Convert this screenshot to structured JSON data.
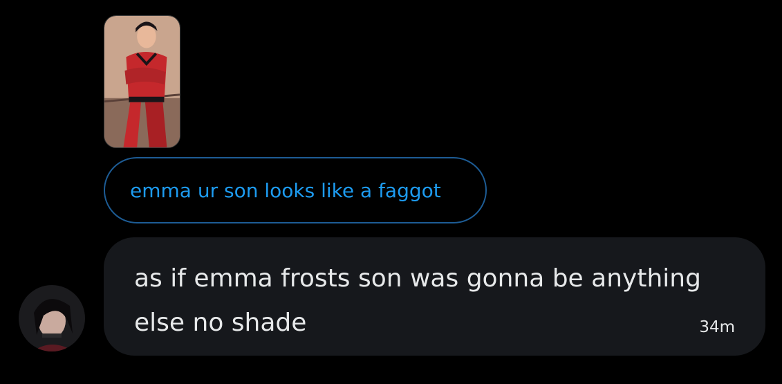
{
  "quoted_message": {
    "text": "emma ur son looks like a faggot"
  },
  "message": {
    "text": "as if emma frosts son was gonna be anything else no shade",
    "time": "34m"
  },
  "colors": {
    "background": "#000000",
    "bubble": "#16181c",
    "quote_text": "#1d9bf0",
    "quote_border": "#1d5c95",
    "message_text": "#e7e9ea"
  }
}
